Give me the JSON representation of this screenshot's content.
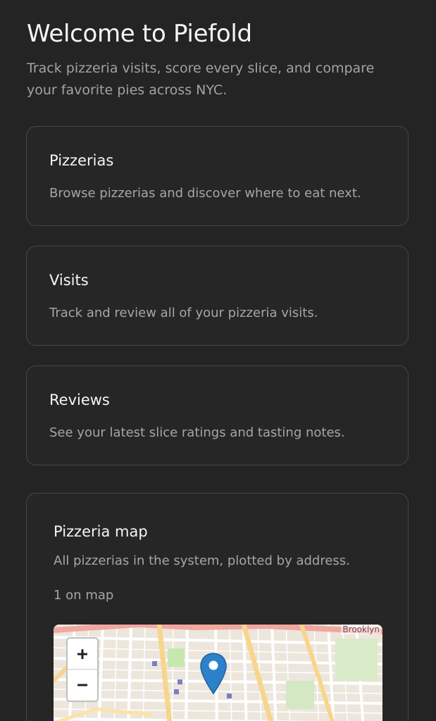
{
  "header": {
    "title": "Welcome to Piefold",
    "subtitle": "Track pizzeria visits, score every slice, and compare your favorite pies across NYC."
  },
  "cards": [
    {
      "title": "Pizzerias",
      "description": "Browse pizzerias and discover where to eat next."
    },
    {
      "title": "Visits",
      "description": "Track and review all of your pizzeria visits."
    },
    {
      "title": "Reviews",
      "description": "See your latest slice ratings and tasting notes."
    }
  ],
  "map_section": {
    "title": "Pizzeria map",
    "description": "All pizzerias in the system, plotted by address.",
    "count": "1 on map",
    "area_label": "Brooklyn",
    "zoom_in": "+",
    "zoom_out": "−",
    "marker_icon": "map-pin-icon"
  },
  "colors": {
    "background": "#242424",
    "card_border": "#464646",
    "marker": "#2b82cb",
    "text_primary": "#f5f5f5",
    "text_secondary": "#a6a6a6"
  }
}
